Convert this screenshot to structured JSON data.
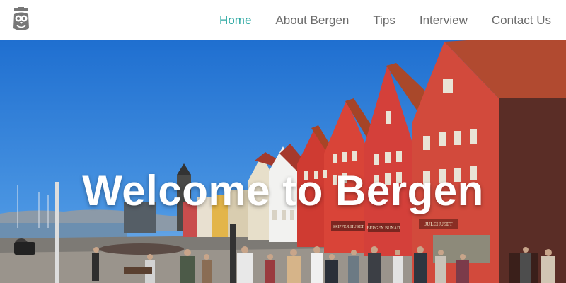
{
  "brand": {
    "logo_icon": "owl-logo-icon"
  },
  "nav": {
    "items": [
      {
        "label": "Home",
        "active": true
      },
      {
        "label": "About Bergen",
        "active": false
      },
      {
        "label": "Tips",
        "active": false
      },
      {
        "label": "Interview",
        "active": false
      },
      {
        "label": "Contact Us",
        "active": false
      }
    ]
  },
  "hero": {
    "title": "Welcome to Bergen",
    "photo_subject": "Bryggen harbourfront with colourful wooden houses",
    "signs": {
      "sign1": "SKIPPER HUSET",
      "sign2": "BERGEN BUNAD",
      "sign3": "JULEHUSET"
    }
  },
  "colors": {
    "accent": "#2aa7a1",
    "nav_text": "#6b6b6b",
    "sky": "#2f7fd8"
  }
}
